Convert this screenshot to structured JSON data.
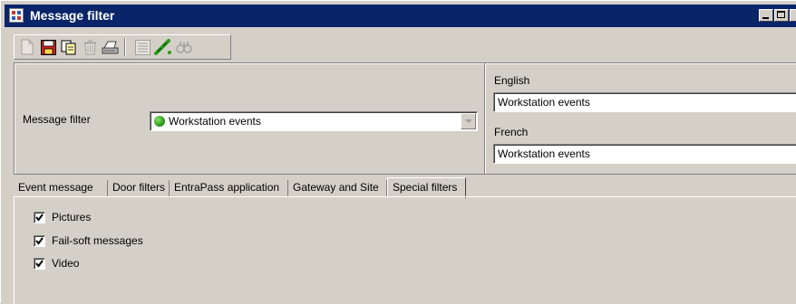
{
  "window": {
    "title": "Message filter"
  },
  "toolbar": {
    "icons": [
      "new-icon",
      "save-icon",
      "copy-icon",
      "delete-icon",
      "print-icon",
      "list-icon",
      "link-icon",
      "find-icon"
    ]
  },
  "filter": {
    "label": "Message filter",
    "selected": "Workstation events",
    "status_color": "#2e9a1a"
  },
  "languages": [
    {
      "label": "English",
      "value": "Workstation events"
    },
    {
      "label": "French",
      "value": "Workstation events"
    }
  ],
  "tabs": [
    {
      "label": "Event message"
    },
    {
      "label": "Door filters"
    },
    {
      "label": "EntraPass application"
    },
    {
      "label": "Gateway and Site"
    },
    {
      "label": "Special filters",
      "active": true
    }
  ],
  "special_filters": [
    {
      "label": "Pictures",
      "checked": true
    },
    {
      "label": "Fail-soft messages",
      "checked": true
    },
    {
      "label": "Video",
      "checked": true
    }
  ],
  "colors": {
    "titlebar": "#0a246a",
    "face": "#d4d0c8"
  }
}
